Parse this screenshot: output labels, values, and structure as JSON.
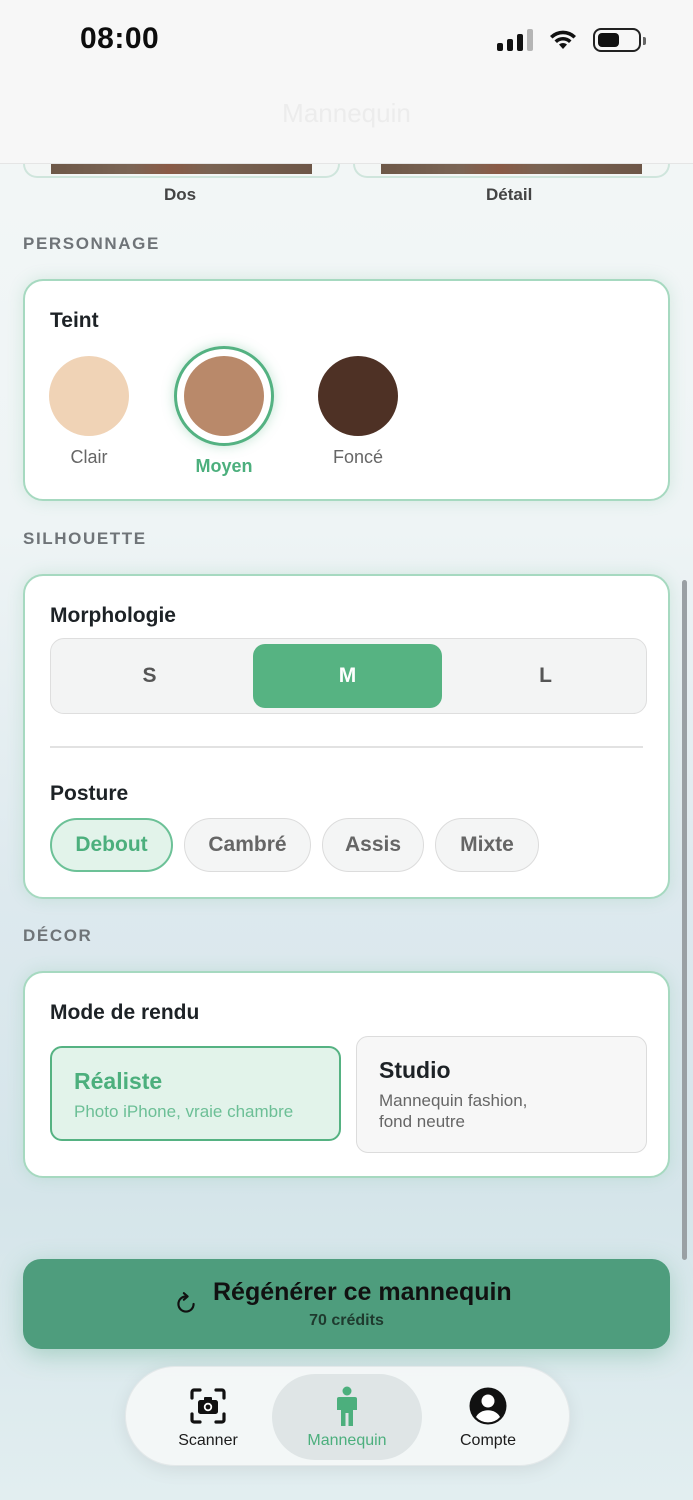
{
  "status_bar": {
    "time": "08:00"
  },
  "nav": {
    "title": "Mannequin"
  },
  "photos": [
    {
      "label": "Dos"
    },
    {
      "label": "Détail"
    }
  ],
  "sections": {
    "personnage": "PERSONNAGE",
    "silhouette": "SILHOUETTE",
    "decor": "DÉCOR"
  },
  "teint": {
    "label": "Teint",
    "options": [
      {
        "label": "Clair",
        "color": "#f0d3b6"
      },
      {
        "label": "Moyen",
        "color": "#b9896a",
        "selected": true
      },
      {
        "label": "Foncé",
        "color": "#4e3125"
      }
    ]
  },
  "morphologie": {
    "label": "Morphologie",
    "options": [
      "S",
      "M",
      "L"
    ],
    "selected": "M"
  },
  "posture": {
    "label": "Posture",
    "options": [
      "Debout",
      "Cambré",
      "Assis",
      "Mixte"
    ],
    "selected": "Debout"
  },
  "mode_rendu": {
    "label": "Mode de rendu",
    "options": [
      {
        "title": "Réaliste",
        "subtitle": "Photo iPhone, vraie chambre",
        "selected": true
      },
      {
        "title": "Studio",
        "subtitle_line1": "Mannequin fashion,",
        "subtitle_line2": "fond neutre"
      }
    ]
  },
  "regenerate": {
    "label": "Régénérer ce mannequin",
    "credits": "70 crédits"
  },
  "tabbar": {
    "items": [
      {
        "label": "Scanner",
        "icon": "camera-scan-icon"
      },
      {
        "label": "Mannequin",
        "icon": "person-icon",
        "active": true
      },
      {
        "label": "Compte",
        "icon": "account-icon"
      }
    ]
  },
  "colors": {
    "accent": "#54b282",
    "accent_light": "#e2f3ea",
    "button": "#4e9d7d"
  }
}
